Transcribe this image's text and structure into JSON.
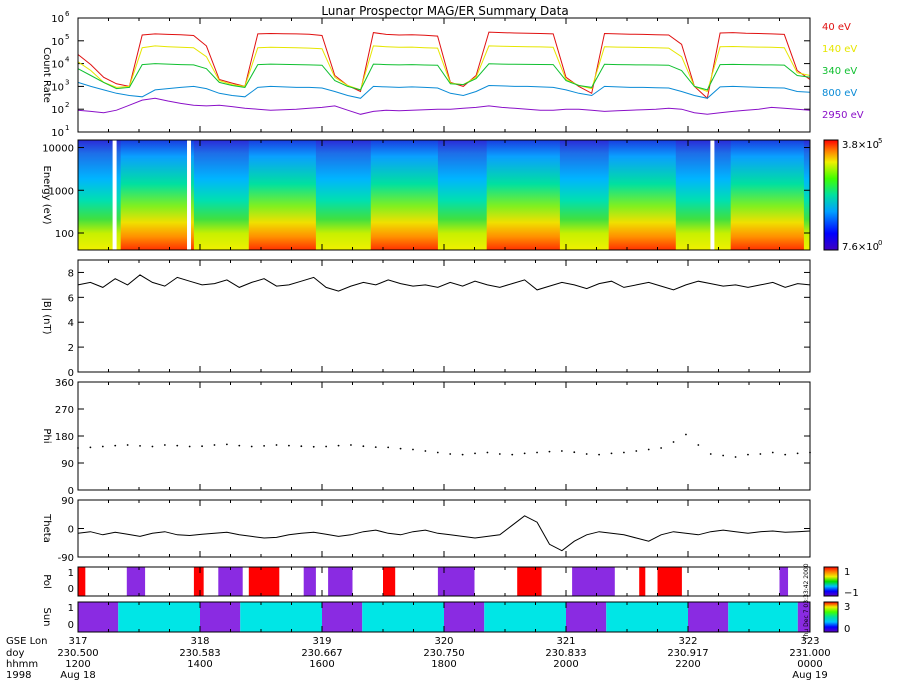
{
  "title": "Lunar Prospector MAG/ER Summary Data",
  "chart_data": [
    {
      "panel": "count-rate",
      "type": "line",
      "ylabel": "Count Rate",
      "yscale": "log",
      "ylim": [
        10,
        1000000
      ],
      "yticks": [
        {
          "v": 10,
          "m": "10",
          "e": "1"
        },
        {
          "v": 100,
          "m": "10",
          "e": "2"
        },
        {
          "v": 1000,
          "m": "10",
          "e": "3"
        },
        {
          "v": 10000,
          "m": "10",
          "e": "4"
        },
        {
          "v": 100000,
          "m": "10",
          "e": "5"
        },
        {
          "v": 1000000,
          "m": "10",
          "e": "6"
        }
      ],
      "series": [
        {
          "name": "40 eV",
          "color": "#e01010",
          "values": [
            25000,
            9000,
            2500,
            1300,
            1000,
            180000,
            200000,
            190000,
            185000,
            170000,
            60000,
            2000,
            1400,
            1000,
            200000,
            210000,
            205000,
            200000,
            195000,
            170000,
            3000,
            1100,
            600,
            230000,
            190000,
            180000,
            185000,
            175000,
            160000,
            1500,
            1000,
            3000,
            240000,
            230000,
            220000,
            215000,
            210000,
            200000,
            2500,
            1000,
            500,
            210000,
            200000,
            195000,
            190000,
            185000,
            180000,
            70000,
            1000,
            300,
            220000,
            230000,
            215000,
            210000,
            200000,
            190000,
            5000,
            2000
          ]
        },
        {
          "name": "140 eV",
          "color": "#e6e600",
          "values": [
            12000,
            5000,
            1500,
            900,
            1000,
            50000,
            60000,
            55000,
            52000,
            50000,
            20000,
            1800,
            1200,
            1000,
            50000,
            52000,
            51000,
            50000,
            48000,
            45000,
            2500,
            1100,
            700,
            60000,
            55000,
            52000,
            53000,
            50000,
            48000,
            1400,
            1200,
            2500,
            60000,
            58000,
            56000,
            55000,
            54000,
            52000,
            2000,
            1100,
            800,
            55000,
            53000,
            52000,
            51000,
            50000,
            48000,
            20000,
            1000,
            600,
            55000,
            56000,
            54000,
            53000,
            52000,
            50000,
            4000,
            3000
          ]
        },
        {
          "name": "340 eV",
          "color": "#10c030",
          "values": [
            6000,
            3000,
            1500,
            800,
            900,
            9000,
            10000,
            9500,
            9000,
            8800,
            6000,
            1500,
            1100,
            900,
            9000,
            9500,
            9200,
            9000,
            8800,
            8500,
            1800,
            1000,
            700,
            9500,
            9000,
            8800,
            9000,
            8700,
            8500,
            1300,
            1200,
            2200,
            9800,
            9500,
            9300,
            9200,
            9100,
            9000,
            1800,
            1100,
            900,
            9300,
            9000,
            8900,
            8800,
            8700,
            8500,
            5000,
            1000,
            700,
            9000,
            9200,
            9000,
            8900,
            8800,
            8600,
            3000,
            2500
          ]
        },
        {
          "name": "800 eV",
          "color": "#0a8bd6",
          "values": [
            1500,
            1000,
            700,
            500,
            400,
            350,
            700,
            800,
            900,
            1000,
            800,
            500,
            400,
            350,
            900,
            1000,
            950,
            900,
            900,
            850,
            600,
            400,
            300,
            1000,
            950,
            900,
            950,
            900,
            850,
            500,
            400,
            600,
            1100,
            1050,
            1000,
            1000,
            950,
            900,
            700,
            500,
            400,
            1000,
            950,
            900,
            900,
            880,
            850,
            600,
            400,
            300,
            950,
            1000,
            950,
            900,
            880,
            850,
            600,
            550
          ]
        },
        {
          "name": "2950 eV",
          "color": "#8a10c8",
          "values": [
            90,
            80,
            70,
            90,
            150,
            250,
            300,
            230,
            180,
            150,
            140,
            150,
            130,
            110,
            100,
            90,
            95,
            100,
            110,
            120,
            140,
            90,
            60,
            80,
            90,
            85,
            90,
            95,
            100,
            100,
            110,
            120,
            140,
            120,
            110,
            100,
            90,
            90,
            100,
            100,
            90,
            80,
            85,
            90,
            95,
            100,
            110,
            100,
            70,
            60,
            70,
            80,
            90,
            100,
            120,
            110,
            100,
            90
          ]
        }
      ],
      "x_range": [
        317,
        323
      ]
    },
    {
      "panel": "energy-spectrogram",
      "type": "heatmap",
      "ylabel": "Energy (eV)",
      "yscale": "log",
      "ylim": [
        40,
        15000
      ],
      "yticks": [
        {
          "v": 100,
          "label": "100"
        },
        {
          "v": 1000,
          "label": "1000"
        },
        {
          "v": 10000,
          "label": "10000"
        }
      ],
      "colorbar": {
        "min_label_m": "7.6",
        "min_label_e": "0",
        "max_label_m": "3.8",
        "max_label_e": "5",
        "scale": "log"
      },
      "data_gaps_day": [
        317.3,
        317.91,
        322.2
      ],
      "high_flux_intervals_day": [
        [
          317.35,
          317.95
        ],
        [
          318.4,
          318.95
        ],
        [
          319.4,
          319.95
        ],
        [
          320.35,
          320.95
        ],
        [
          321.35,
          321.9
        ],
        [
          322.35,
          322.95
        ]
      ]
    },
    {
      "panel": "magnitude-b",
      "type": "line",
      "ylabel": "|B| (nT)",
      "ylim": [
        0,
        9
      ],
      "yticks": [
        0,
        2,
        4,
        6,
        8
      ],
      "values": [
        7.0,
        7.2,
        6.8,
        7.5,
        7.0,
        7.8,
        7.2,
        6.9,
        7.6,
        7.3,
        7.0,
        7.1,
        7.4,
        6.8,
        7.2,
        7.5,
        6.9,
        7.0,
        7.3,
        7.6,
        6.8,
        6.5,
        6.9,
        7.2,
        7.0,
        7.4,
        7.1,
        6.9,
        7.0,
        6.8,
        7.2,
        6.9,
        7.3,
        7.0,
        6.8,
        7.1,
        7.4,
        6.6,
        6.9,
        7.2,
        7.0,
        6.7,
        7.1,
        7.3,
        6.8,
        7.0,
        7.2,
        6.9,
        6.6,
        7.0,
        7.3,
        7.1,
        6.9,
        7.0,
        6.8,
        7.0,
        7.2,
        6.8,
        7.1,
        7.0
      ]
    },
    {
      "panel": "phi",
      "type": "scatter",
      "ylabel": "Phi",
      "ylim": [
        0,
        360
      ],
      "yticks": [
        0,
        90,
        180,
        270,
        360
      ],
      "values": [
        140,
        142,
        145,
        148,
        150,
        147,
        145,
        150,
        148,
        145,
        146,
        150,
        152,
        148,
        145,
        147,
        150,
        148,
        146,
        144,
        145,
        148,
        150,
        146,
        143,
        142,
        138,
        135,
        130,
        125,
        120,
        118,
        122,
        125,
        120,
        118,
        122,
        125,
        128,
        130,
        126,
        120,
        118,
        122,
        125,
        130,
        135,
        140,
        160,
        185,
        150,
        120,
        115,
        110,
        118,
        120,
        125,
        118,
        122,
        125
      ]
    },
    {
      "panel": "theta",
      "type": "line",
      "ylabel": "Theta",
      "ylim": [
        -90,
        90
      ],
      "yticks": [
        -90,
        0,
        90
      ],
      "values": [
        -15,
        -10,
        -20,
        -12,
        -18,
        -25,
        -15,
        -10,
        -20,
        -22,
        -18,
        -15,
        -12,
        -20,
        -25,
        -30,
        -28,
        -20,
        -15,
        -12,
        -18,
        -25,
        -20,
        -10,
        -5,
        -15,
        -20,
        -10,
        -5,
        -15,
        -20,
        -25,
        -30,
        -25,
        -20,
        10,
        40,
        20,
        -50,
        -70,
        -40,
        -20,
        -10,
        -15,
        -20,
        -30,
        -40,
        -20,
        -10,
        -15,
        -20,
        -10,
        -5,
        -10,
        -15,
        -10,
        -8,
        -12,
        -10,
        -8
      ]
    },
    {
      "panel": "pol",
      "type": "heatmap",
      "ylabel": "Pol",
      "yticks": [
        0,
        1
      ],
      "colorbar": {
        "min_label": "−1",
        "max_label": "1"
      },
      "bands": [
        {
          "day": [
            317.0,
            317.06
          ],
          "color": "#ff0000"
        },
        {
          "day": [
            317.4,
            317.55
          ],
          "color": "#8a2be2"
        },
        {
          "day": [
            317.95,
            318.03
          ],
          "color": "#ff0000"
        },
        {
          "day": [
            318.15,
            318.35
          ],
          "color": "#8a2be2"
        },
        {
          "day": [
            318.4,
            318.65
          ],
          "color": "#ff0000"
        },
        {
          "day": [
            318.85,
            318.95
          ],
          "color": "#8a2be2"
        },
        {
          "day": [
            319.05,
            319.25
          ],
          "color": "#8a2be2"
        },
        {
          "day": [
            319.5,
            319.6
          ],
          "color": "#ff0000"
        },
        {
          "day": [
            319.95,
            320.25
          ],
          "color": "#8a2be2"
        },
        {
          "day": [
            320.6,
            320.8
          ],
          "color": "#ff0000"
        },
        {
          "day": [
            321.05,
            321.4
          ],
          "color": "#8a2be2"
        },
        {
          "day": [
            321.6,
            321.65
          ],
          "color": "#ff0000"
        },
        {
          "day": [
            321.75,
            321.95
          ],
          "color": "#ff0000"
        },
        {
          "day": [
            322.75,
            322.82
          ],
          "color": "#8a2be2"
        }
      ]
    },
    {
      "panel": "sun",
      "type": "heatmap",
      "ylabel": "Sun",
      "yticks": [
        0,
        1
      ],
      "colorbar": {
        "min_label": "0",
        "max_label": "3"
      },
      "bands": [
        {
          "day": [
            317.0,
            317.33
          ],
          "color": "#8a2be2"
        },
        {
          "day": [
            317.33,
            318.0
          ],
          "color": "#00e6e6"
        },
        {
          "day": [
            318.0,
            318.33
          ],
          "color": "#8a2be2"
        },
        {
          "day": [
            318.33,
            319.0
          ],
          "color": "#00e6e6"
        },
        {
          "day": [
            319.0,
            319.33
          ],
          "color": "#8a2be2"
        },
        {
          "day": [
            319.33,
            320.0
          ],
          "color": "#00e6e6"
        },
        {
          "day": [
            320.0,
            320.33
          ],
          "color": "#8a2be2"
        },
        {
          "day": [
            320.33,
            321.0
          ],
          "color": "#00e6e6"
        },
        {
          "day": [
            321.0,
            321.33
          ],
          "color": "#8a2be2"
        },
        {
          "day": [
            321.33,
            322.0
          ],
          "color": "#00e6e6"
        },
        {
          "day": [
            322.0,
            322.33
          ],
          "color": "#8a2be2"
        },
        {
          "day": [
            322.33,
            322.9
          ],
          "color": "#00e6e6"
        },
        {
          "day": [
            322.9,
            323.0
          ],
          "color": "#8a2be2"
        }
      ]
    }
  ],
  "x_axis": {
    "row_labels": [
      "GSE Lon",
      "doy",
      "hhmm",
      "1998"
    ],
    "ticks": [
      {
        "gse": "317",
        "doy": "230.500",
        "hhmm": "1200",
        "date": "Aug 18"
      },
      {
        "gse": "318",
        "doy": "230.583",
        "hhmm": "1400",
        "date": ""
      },
      {
        "gse": "319",
        "doy": "230.667",
        "hhmm": "1600",
        "date": ""
      },
      {
        "gse": "320",
        "doy": "230.750",
        "hhmm": "1800",
        "date": ""
      },
      {
        "gse": "321",
        "doy": "230.833",
        "hhmm": "2000",
        "date": ""
      },
      {
        "gse": "322",
        "doy": "230.917",
        "hhmm": "2200",
        "date": ""
      },
      {
        "gse": "323",
        "doy": "231.000",
        "hhmm": "0000",
        "date": "Aug 19"
      }
    ]
  },
  "side_note": "Thu Dec 7 03:33:42 2000",
  "colors": {
    "axis": "#000000",
    "background": "#ffffff"
  }
}
